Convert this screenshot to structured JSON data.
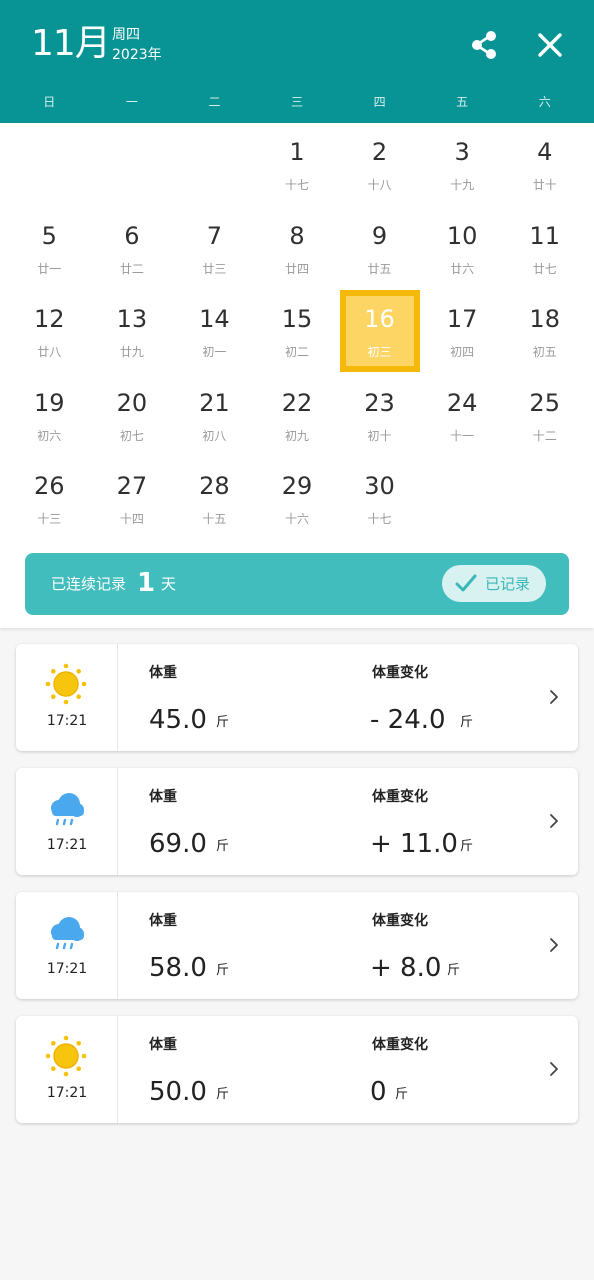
{
  "header": {
    "month": "11月",
    "weekday": "周四",
    "year": "2023年",
    "share_icon": "share-icon",
    "close_icon": "close-icon",
    "bg_color": "#089494"
  },
  "weekdays": [
    "日",
    "一",
    "二",
    "三",
    "四",
    "五",
    "六"
  ],
  "calendar": {
    "selected_day": "16",
    "selected_color": "#f5b90b",
    "days": [
      {
        "day": "",
        "lunar": ""
      },
      {
        "day": "",
        "lunar": ""
      },
      {
        "day": "",
        "lunar": ""
      },
      {
        "day": "1",
        "lunar": "十七"
      },
      {
        "day": "2",
        "lunar": "十八"
      },
      {
        "day": "3",
        "lunar": "十九"
      },
      {
        "day": "4",
        "lunar": "廿十"
      },
      {
        "day": "5",
        "lunar": "廿一"
      },
      {
        "day": "6",
        "lunar": "廿二"
      },
      {
        "day": "7",
        "lunar": "廿三"
      },
      {
        "day": "8",
        "lunar": "廿四"
      },
      {
        "day": "9",
        "lunar": "廿五"
      },
      {
        "day": "10",
        "lunar": "廿六"
      },
      {
        "day": "11",
        "lunar": "廿七"
      },
      {
        "day": "12",
        "lunar": "廿八"
      },
      {
        "day": "13",
        "lunar": "廿九"
      },
      {
        "day": "14",
        "lunar": "初一"
      },
      {
        "day": "15",
        "lunar": "初二"
      },
      {
        "day": "16",
        "lunar": "初三"
      },
      {
        "day": "17",
        "lunar": "初四"
      },
      {
        "day": "18",
        "lunar": "初五"
      },
      {
        "day": "19",
        "lunar": "初六"
      },
      {
        "day": "20",
        "lunar": "初七"
      },
      {
        "day": "21",
        "lunar": "初八"
      },
      {
        "day": "22",
        "lunar": "初九"
      },
      {
        "day": "23",
        "lunar": "初十"
      },
      {
        "day": "24",
        "lunar": "十一"
      },
      {
        "day": "25",
        "lunar": "十二"
      },
      {
        "day": "26",
        "lunar": "十三"
      },
      {
        "day": "27",
        "lunar": "十四"
      },
      {
        "day": "28",
        "lunar": "十五"
      },
      {
        "day": "29",
        "lunar": "十六"
      },
      {
        "day": "30",
        "lunar": "十七"
      }
    ]
  },
  "streak": {
    "prefix": "已连续记录",
    "count": "1",
    "suffix": "天",
    "recorded_label": "已记录",
    "check_icon": "check-icon",
    "bg_color": "#42bdbd"
  },
  "records": [
    {
      "weather_icon": "sun-icon",
      "time": "17:21",
      "weight_label": "体重",
      "weight": "45.0",
      "weight_unit": "斤",
      "change_label": "体重变化",
      "change": "- 24.0",
      "change_unit": "斤"
    },
    {
      "weather_icon": "rain-cloud-icon",
      "time": "17:21",
      "weight_label": "体重",
      "weight": "69.0",
      "weight_unit": "斤",
      "change_label": "体重变化",
      "change": "+ 11.0",
      "change_unit": "斤"
    },
    {
      "weather_icon": "rain-cloud-icon",
      "time": "17:21",
      "weight_label": "体重",
      "weight": "58.0",
      "weight_unit": "斤",
      "change_label": "体重变化",
      "change": "+ 8.0",
      "change_unit": "斤"
    },
    {
      "weather_icon": "sun-icon",
      "time": "17:21",
      "weight_label": "体重",
      "weight": "50.0",
      "weight_unit": "斤",
      "change_label": "体重变化",
      "change": "0",
      "change_unit": "斤"
    }
  ]
}
